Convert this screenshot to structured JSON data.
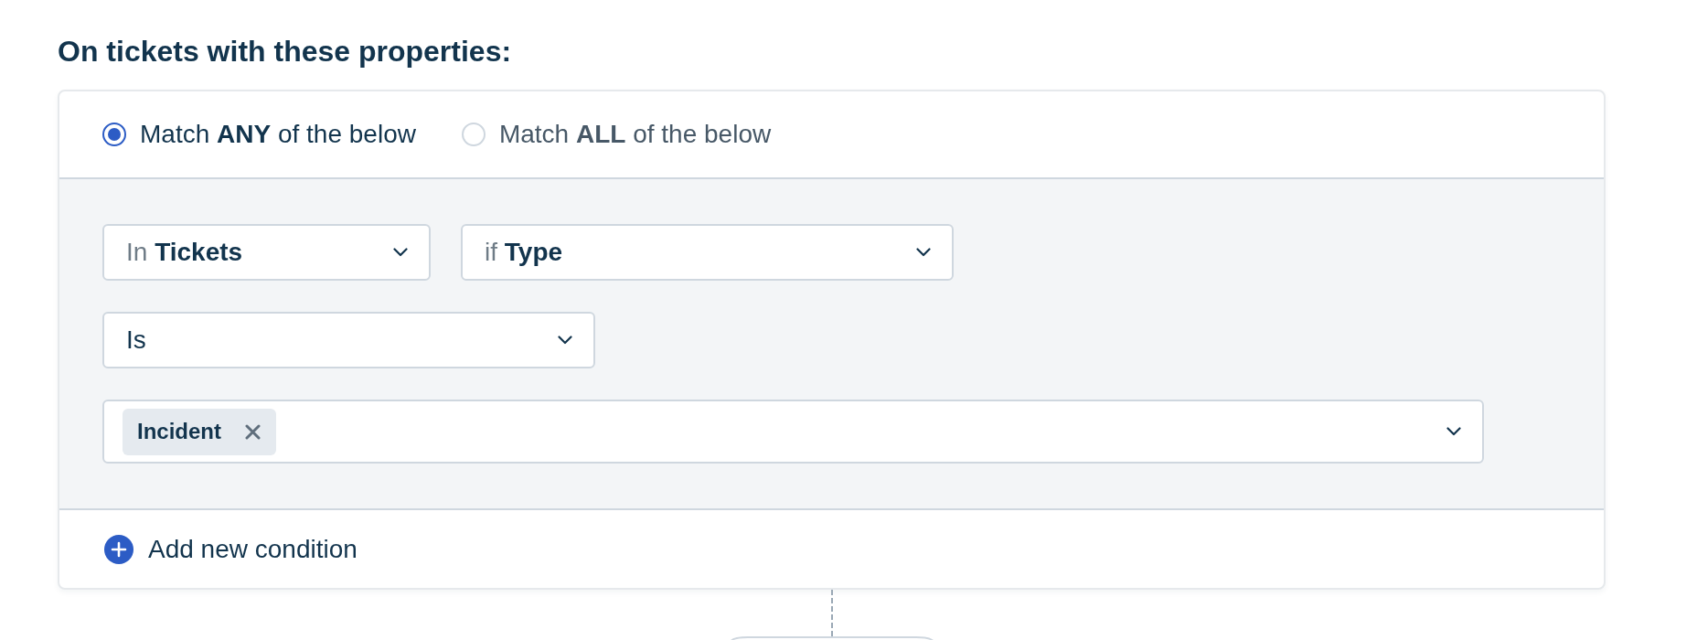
{
  "heading": "On tickets with these properties:",
  "match_options": [
    {
      "label": "Match **ANY** of the below",
      "selected": true
    },
    {
      "label": "Match **ALL** of the below",
      "selected": false
    }
  ],
  "condition_rows": [
    {
      "fields": [
        {
          "kind": "select",
          "prefix": "In",
          "value": "Tickets"
        },
        {
          "kind": "select",
          "prefix": "if",
          "value": "Type"
        }
      ]
    },
    {
      "fields": [
        {
          "kind": "select",
          "value": "Is"
        }
      ]
    },
    {
      "fields": [
        {
          "kind": "multiselect",
          "chips": [
            {
              "label": "Incident"
            }
          ]
        }
      ]
    }
  ],
  "add_condition": {
    "label": "Add new condition"
  }
}
